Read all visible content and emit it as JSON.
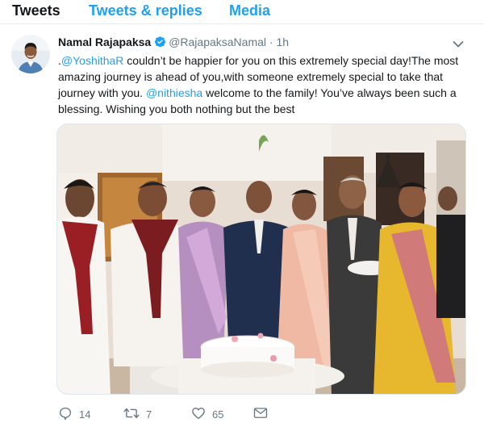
{
  "tabs": [
    {
      "label": "Tweets",
      "active": true
    },
    {
      "label": "Tweets & replies",
      "active": false
    },
    {
      "label": "Media",
      "active": false
    }
  ],
  "tweet": {
    "author_name": "Namal Rajapaksa",
    "handle": "@RajapaksaNamal",
    "separator": "·",
    "time": "1h",
    "text_parts": [
      ".",
      "@YoshithaR",
      " couldn’t be happier for you on this extremely special day!The most amazing journey is ahead of you,with someone extremely special to take that journey with you. ",
      "@nithiesha",
      " welcome to the family! You’ve always been such a blessing. Wishing you both nothing but the best"
    ],
    "counts": {
      "replies": "14",
      "retweets": "7",
      "likes": "65"
    }
  },
  "colors": {
    "accent": "#1da1f2",
    "text": "#14171a",
    "muted": "#657786"
  },
  "icons": [
    "verified-badge-icon",
    "chevron-down-icon",
    "reply-icon",
    "retweet-icon",
    "like-icon",
    "direct-message-icon"
  ]
}
